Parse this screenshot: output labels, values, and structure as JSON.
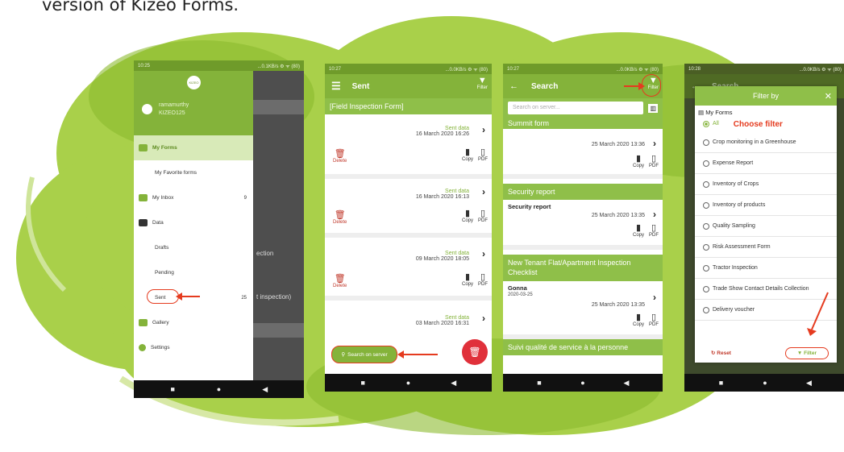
{
  "caption": "version of Kizeo Forms.",
  "colors": {
    "green": "#84b33a",
    "dark_green": "#6f9b2a",
    "red": "#e53b1f",
    "nav": "#111111"
  },
  "nav_icons": [
    "square-icon",
    "circle-icon",
    "back-triangle-icon"
  ],
  "phone1": {
    "status_time": "10:25",
    "status_right": "...0.1KB/s ⚙ ᯤ (80)",
    "logo_text": "KIZEO",
    "user_name": "ramamurthy",
    "user_id": "KIZEO125",
    "menu": {
      "my_forms": "My Forms",
      "my_favorite_forms": "My Favorite forms",
      "my_inbox": "My Inbox",
      "inbox_count": "9",
      "data": "Data",
      "drafts": "Drafts",
      "pending": "Pending",
      "sent": "Sent",
      "sent_count": "25",
      "gallery": "Gallery",
      "settings": "Settings"
    },
    "background_texts": [
      "ection",
      "t inspection)"
    ]
  },
  "phone2": {
    "status_time": "10:27",
    "status_right": "...0.0KB/s ⚙ ᯤ (80)",
    "title": "Sent",
    "filter_label": "Filter",
    "section": "[Field Inspection Form]",
    "cards": [
      {
        "sent_label": "Sent data",
        "date": "16 March 2020 16:26"
      },
      {
        "sent_label": "Sent data",
        "date": "16 March 2020 16:13"
      },
      {
        "sent_label": "Sent data",
        "date": "09 March 2020 18:05"
      },
      {
        "sent_label": "Sent data",
        "date": "03 March 2020 16:31"
      }
    ],
    "delete_label": "Delete",
    "copy_label": "Copy",
    "pdf_label": "PDF",
    "search_button": "Search on server"
  },
  "phone3": {
    "status_time": "10:27",
    "status_right": "...0.0KB/s ⚙ ᯤ (80)",
    "title": "Search",
    "filter_label": "Filter",
    "search_placeholder": "Search on server...",
    "sections": [
      {
        "title": "Summit form",
        "item_title": "",
        "item_sub": "",
        "date": "25 March 2020 13:36"
      },
      {
        "title": "Security report",
        "item_title": "Security report",
        "item_sub": "",
        "date": "25 March 2020 13:35"
      },
      {
        "title": "New Tenant Flat/Apartment Inspection Checklist",
        "item_title": "Gonna",
        "item_sub": "2020-03-25",
        "date": "25 March 2020 13:35"
      }
    ],
    "last_section": "Suivi qualité de service à la personne",
    "copy_label": "Copy",
    "pdf_label": "PDF"
  },
  "phone4": {
    "status_time": "10:28",
    "status_right": "...0.0KB/s ⚙ ᯤ (80)",
    "bg_title": "Search",
    "dialog_title": "Filter by",
    "my_forms": "My Forms",
    "all_label": "All",
    "choose_filter": "Choose filter",
    "options": [
      "Crop monitoring in a Greenhouse",
      "Expense Report",
      "Inventory of Crops",
      "Inventory of products",
      "Quality Sampling",
      "Risk Assessment Form",
      "Tractor Inspection",
      "Trade Show Contact Details Collection",
      "Delivery voucher"
    ],
    "reset_label": "Reset",
    "filter_button": "Filter"
  }
}
